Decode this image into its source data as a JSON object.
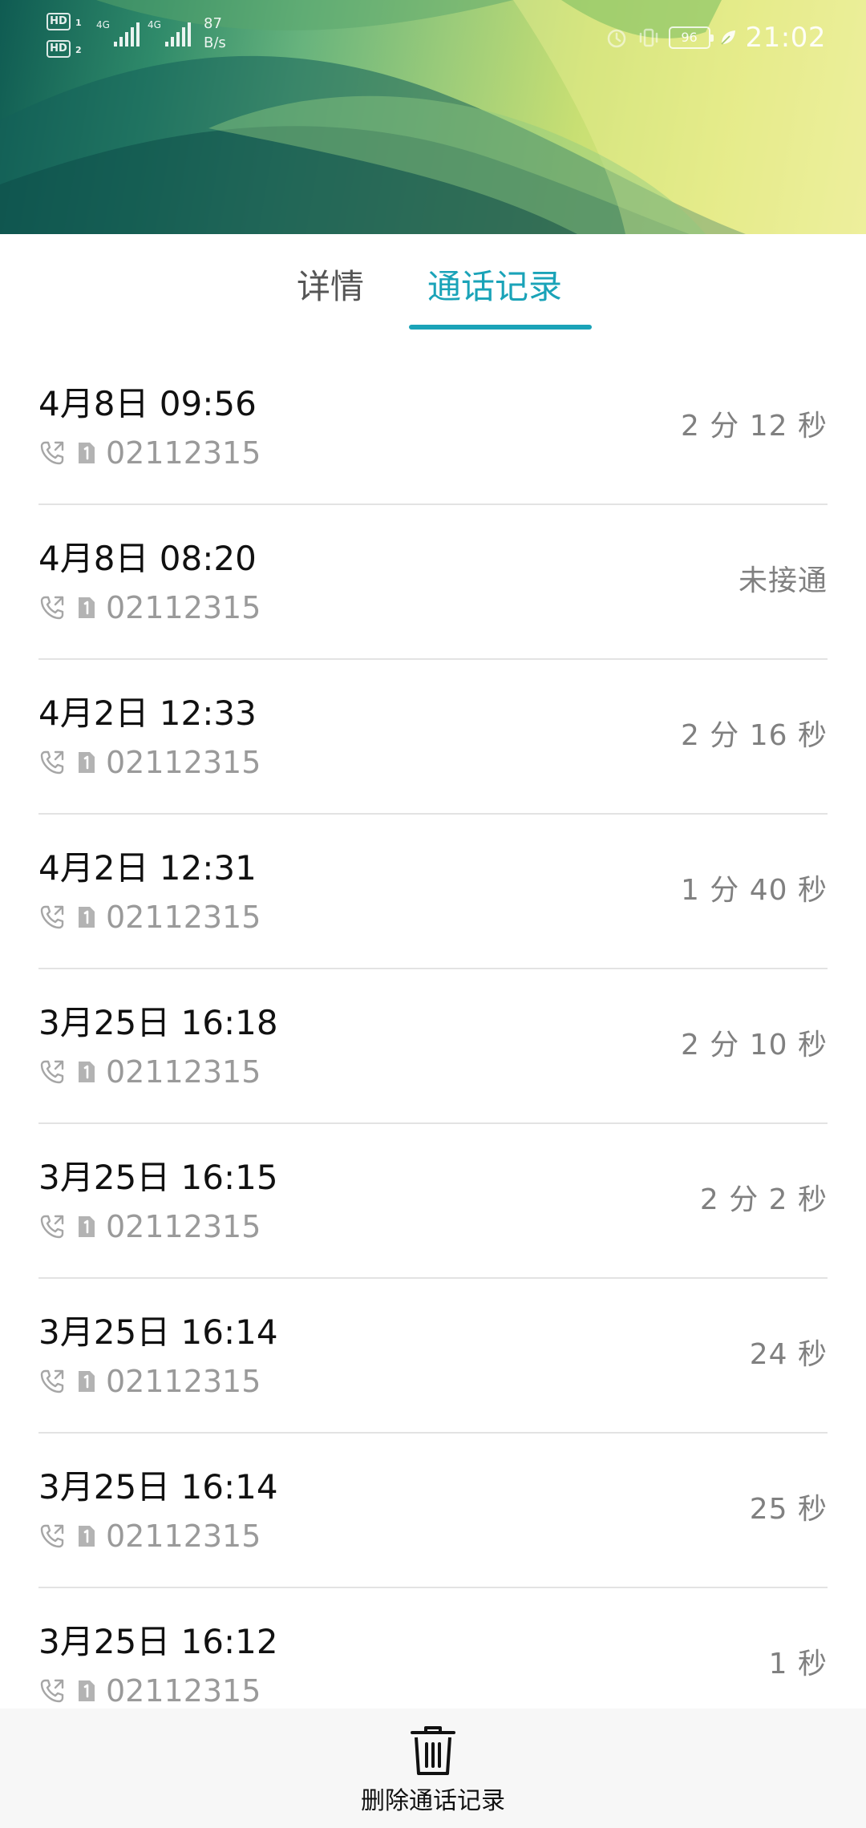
{
  "status_bar": {
    "hd1": "HD",
    "hd1_sim": "1",
    "hd2": "HD",
    "hd2_sim": "2",
    "net1": "4G",
    "net2": "4G",
    "speed_value": "87",
    "speed_unit": "B/s",
    "battery": "96",
    "time": "21:02"
  },
  "tabs": [
    {
      "label": "详情",
      "active": false
    },
    {
      "label": "通话记录",
      "active": true
    }
  ],
  "accent_color": "#1aa3b8",
  "calls": [
    {
      "date": "4月8日 09:56",
      "number": "02112315",
      "duration": "2 分 12 秒"
    },
    {
      "date": "4月8日 08:20",
      "number": "02112315",
      "duration": "未接通"
    },
    {
      "date": "4月2日 12:33",
      "number": "02112315",
      "duration": "2 分 16 秒"
    },
    {
      "date": "4月2日 12:31",
      "number": "02112315",
      "duration": "1 分 40 秒"
    },
    {
      "date": "3月25日 16:18",
      "number": "02112315",
      "duration": "2 分 10 秒"
    },
    {
      "date": "3月25日 16:15",
      "number": "02112315",
      "duration": "2 分 2 秒"
    },
    {
      "date": "3月25日 16:14",
      "number": "02112315",
      "duration": "24 秒"
    },
    {
      "date": "3月25日 16:14",
      "number": "02112315",
      "duration": "25 秒"
    },
    {
      "date": "3月25日 16:12",
      "number": "02112315",
      "duration": "1 秒"
    }
  ],
  "call_icons": {
    "type_icon": "outgoing-call-icon",
    "sim_icon": "sim-1-icon"
  },
  "bottom_action": {
    "icon": "trash-icon",
    "label": "删除通话记录"
  }
}
